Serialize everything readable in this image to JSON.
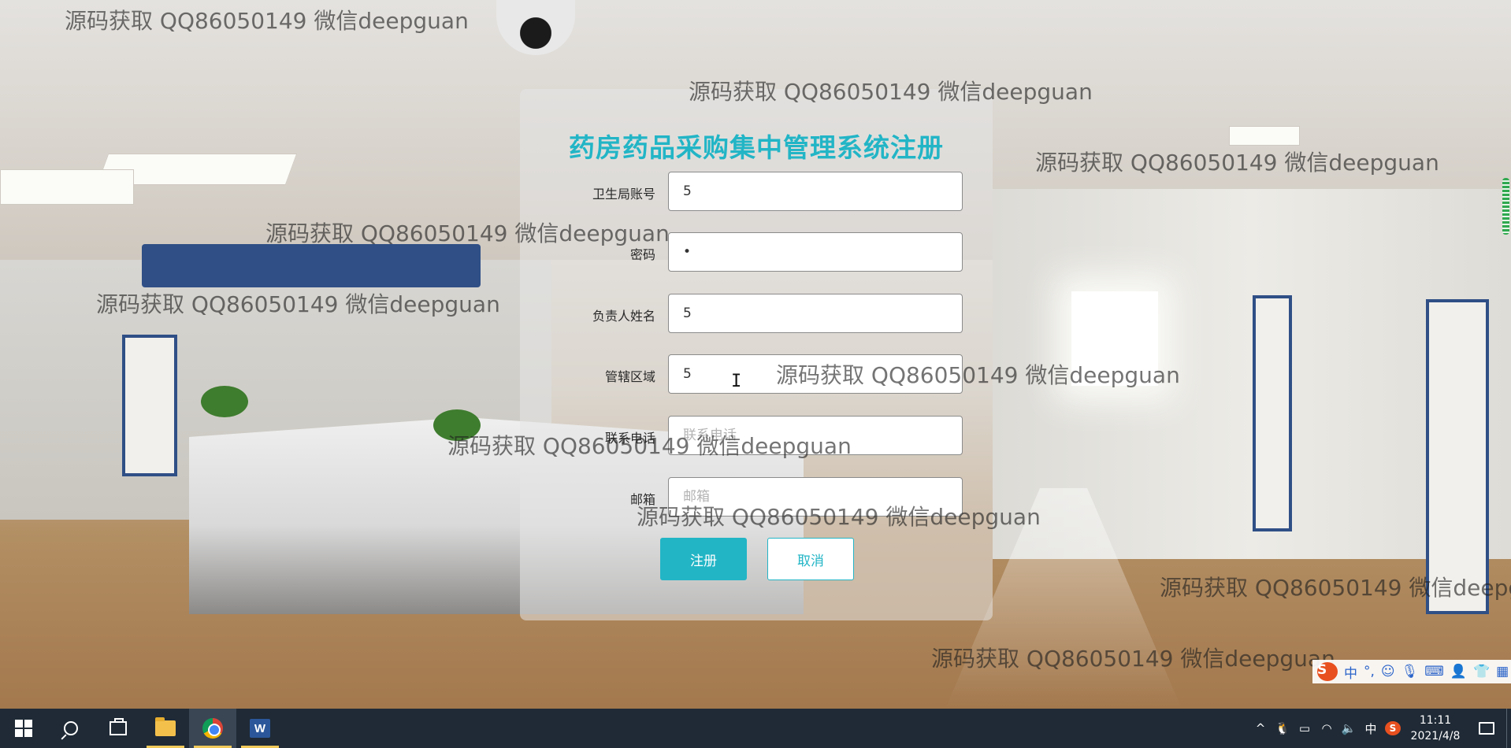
{
  "register_form": {
    "title": "药房药品采购集中管理系统注册",
    "fields": [
      {
        "label": "卫生局账号",
        "value": "5",
        "placeholder": "",
        "type": "text"
      },
      {
        "label": "密码",
        "value": "•",
        "placeholder": "",
        "type": "password"
      },
      {
        "label": "负责人姓名",
        "value": "5",
        "placeholder": "",
        "type": "text"
      },
      {
        "label": "管辖区域",
        "value": "5",
        "placeholder": "",
        "type": "text"
      },
      {
        "label": "联系电话",
        "value": "",
        "placeholder": "联系电话",
        "type": "text"
      },
      {
        "label": "邮箱",
        "value": "",
        "placeholder": "邮箱",
        "type": "text"
      }
    ],
    "register_label": "注册",
    "cancel_label": "取消",
    "accent_color": "#22b5c6"
  },
  "watermark_text": "源码获取 QQ86050149 微信deepguan",
  "ime_toolbar": {
    "logo": "S",
    "mode": "中",
    "punct": "°,",
    "icons": [
      "emoji-icon",
      "microphone-icon",
      "keyboard-icon",
      "user-icon",
      "skin-icon",
      "grid-icon"
    ]
  },
  "taskbar": {
    "apps": [
      "windows-start-icon",
      "search-icon",
      "task-view-icon",
      "file-explorer-icon",
      "chrome-icon",
      "word-icon"
    ],
    "tray": {
      "ime_indicator": "中",
      "time": "11:11",
      "date": "2021/4/8"
    }
  }
}
